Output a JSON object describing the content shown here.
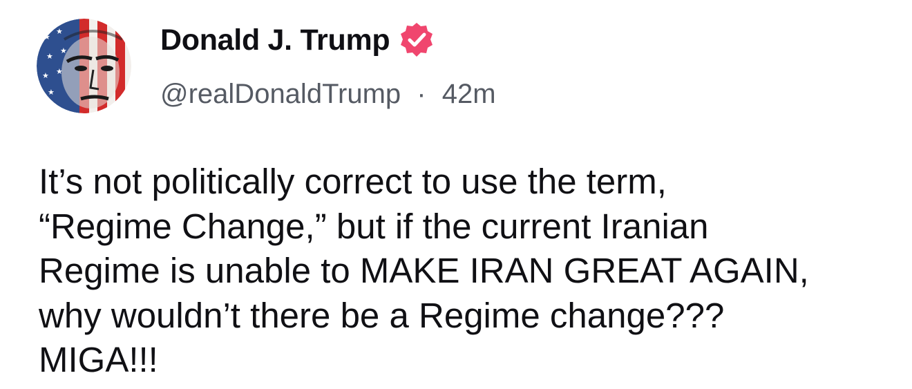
{
  "author": {
    "display_name": "Donald J. Trump",
    "handle": "@realDonaldTrump",
    "separator": "·",
    "time_ago": "42m",
    "verified_badge_color": "#f0466e",
    "avatar_icon": "profile-portrait-flag-avatar"
  },
  "post": {
    "lines": [
      "It’s not politically correct to use the term,",
      "“Regime Change,” but if the current Iranian",
      "Regime is unable to MAKE IRAN GREAT AGAIN,",
      "why wouldn’t there be a Regime change???",
      "MIGA!!!"
    ]
  }
}
